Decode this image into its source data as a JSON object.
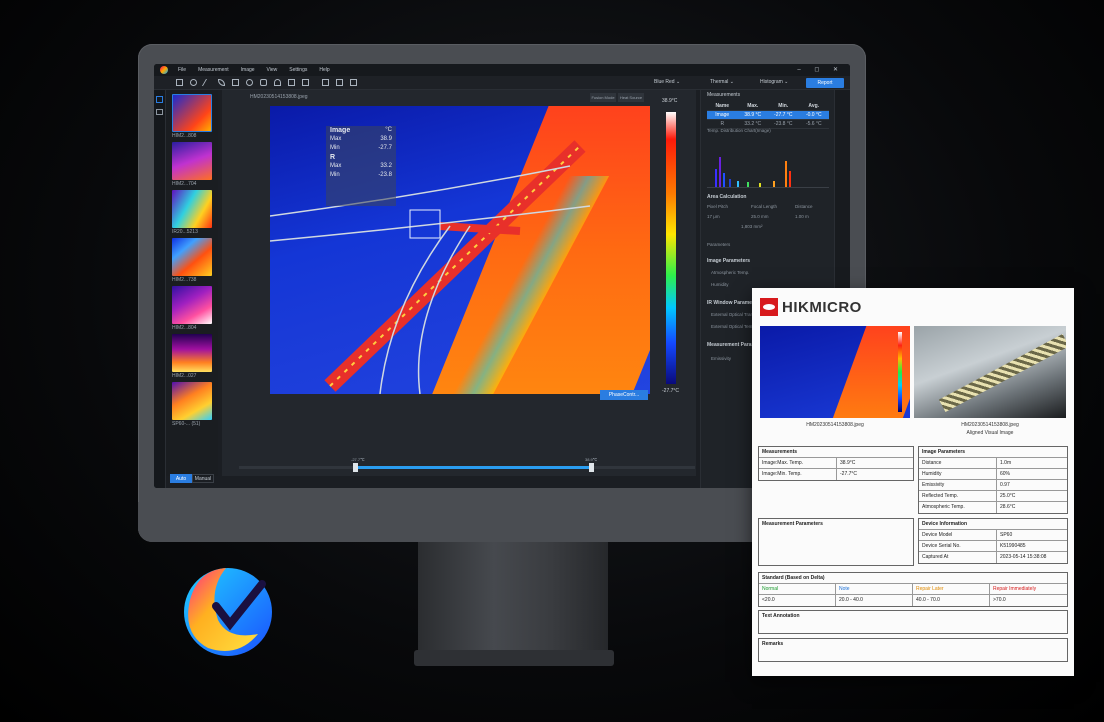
{
  "app": {
    "menus": [
      "File",
      "Measurement",
      "Image",
      "View",
      "Settings",
      "Help"
    ],
    "window_controls": "– ◻ ✕"
  },
  "toolbar": {
    "palette": "Blue Red",
    "mode": "Thermal",
    "histogram": "Histogram",
    "report_label": "Report"
  },
  "thumbnails": [
    {
      "label": "HIM2...808"
    },
    {
      "label": "HIM2...704"
    },
    {
      "label": "IR20...5213"
    },
    {
      "label": "HIM2...738"
    },
    {
      "label": "HIM2...804"
    },
    {
      "label": "HIM2...027"
    },
    {
      "label": "SP60-... (51)"
    }
  ],
  "mode_buttons": {
    "auto": "Auto",
    "manual": "Manual"
  },
  "canvas": {
    "filename": "HM20230514153808.jpeg",
    "btn1": "Fusion Mode",
    "btn2": "Heat Source",
    "overlay": {
      "image_label": "Image",
      "unit": "°C",
      "max_label": "Max",
      "max_val": "38.9",
      "min_label": "Min",
      "min_val": "-27.7",
      "r_label": "R",
      "r_max_label": "Max",
      "r_max_val": "33.2",
      "r_min_label": "Min",
      "r_min_val": "-23.8"
    },
    "legend_max": "38.9°C",
    "legend_min": "-27.7°C",
    "phase_btn": "PhaseContr...",
    "slider_left": "-27.7℃",
    "slider_right": "38.9℃"
  },
  "right_panel": {
    "title": "Measurements",
    "headers": [
      "Name",
      "Max.",
      "Min.",
      "Avg."
    ],
    "rows": [
      {
        "name": "Image",
        "max": "38.9 °C",
        "min": "-27.7 °C",
        "avg": "-0.0 °C"
      },
      {
        "name": "R",
        "max": "33.2 °C",
        "min": "-23.8 °C",
        "avg": "-5.6 °C"
      }
    ],
    "chart_title": "Temp. Distribution Chart(Image)",
    "area_title": "Area Calculation",
    "area_headers": [
      "Pixel Pitch",
      "Focal Length",
      "Distance"
    ],
    "area_values": [
      "17 μm",
      "25.0 mm",
      "1.00 m"
    ],
    "area_result": "1,803 mm²",
    "parameters": "Parameters",
    "image_params": "Image Parameters",
    "atm_temp": "Atmospheric Temp.",
    "humidity": "Humidity",
    "ir_window": "IR Window Parameters",
    "ext_trans": "External Optical Transmi...",
    "ext_temp": "External Optical Tempera...",
    "meas_params": "Measurement Paramete...",
    "emissivity": "Emissivity"
  },
  "report": {
    "brand": "HIKMICRO",
    "img1_caption": "HM20230514153808.jpeg",
    "img2_caption1": "HM20230514153808.jpeg",
    "img2_caption2": "Aligned Visual Image",
    "measurements_title": "Measurements",
    "meas_rows": [
      {
        "k": "Image:Max. Temp.",
        "v": "38.9°C"
      },
      {
        "k": "Image:Min. Temp.",
        "v": "-27.7°C"
      }
    ],
    "image_params_title": "Image Parameters",
    "image_params": [
      {
        "k": "Distance",
        "v": "1.0m"
      },
      {
        "k": "Humidity",
        "v": "60%"
      },
      {
        "k": "Emissivity",
        "v": "0.97"
      },
      {
        "k": "Reflected Temp.",
        "v": "25.0°C"
      },
      {
        "k": "Atmospheric Temp.",
        "v": "28.6°C"
      }
    ],
    "meas_params_title": "Measurement Parameters",
    "device_info_title": "Device Information",
    "device_info": [
      {
        "k": "Device Model",
        "v": "SP60"
      },
      {
        "k": "Device Serial No.",
        "v": "K51990485"
      },
      {
        "k": "Captured At",
        "v": "2023-05-14 15:38:08"
      }
    ],
    "standard_title": "Standard (Based on Delta)",
    "standard_headers": [
      "Normal",
      "Note",
      "Repair Later",
      "Repair Immediately"
    ],
    "standard_values": [
      "<20.0",
      "20.0 - 40.0",
      "40.0 - 70.0",
      ">70.0"
    ],
    "text_annotation": "Text Annotation",
    "remarks": "Remarks"
  },
  "colors": {
    "accent": "#2a7de1",
    "brand_red": "#d7191c",
    "std_normal": "#1a9b2e",
    "std_note": "#1a6fd6",
    "std_later": "#e08a00",
    "std_immediate": "#d71a1a"
  }
}
